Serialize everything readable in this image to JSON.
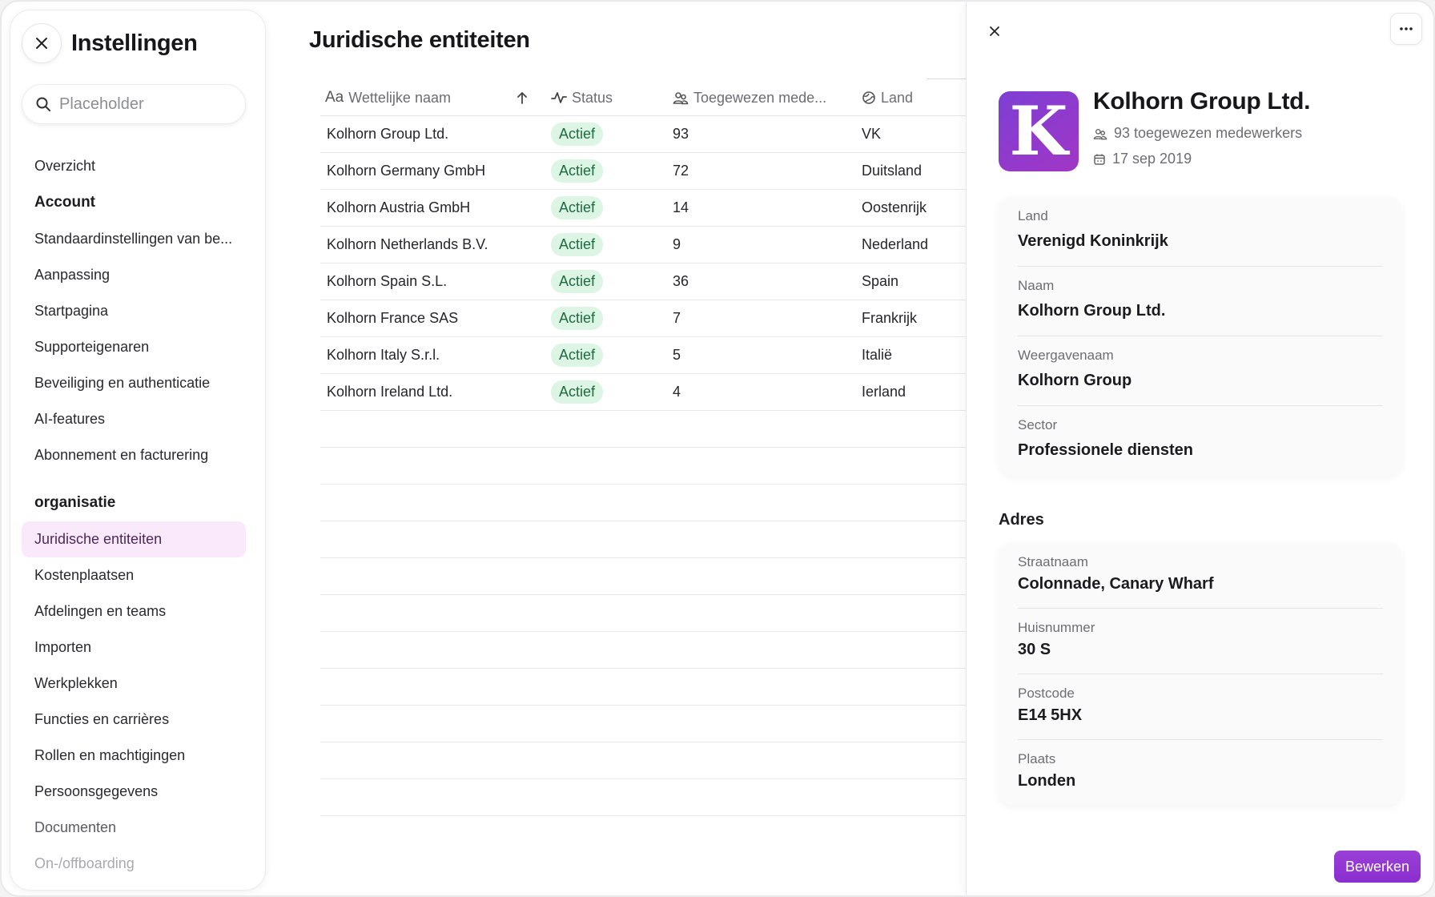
{
  "sidebar": {
    "title": "Instellingen",
    "search_placeholder": "Placeholder",
    "items": [
      {
        "type": "item",
        "label": "Overzicht"
      },
      {
        "type": "section",
        "label": "Account"
      },
      {
        "type": "item",
        "label": "Standaardinstellingen van be..."
      },
      {
        "type": "item",
        "label": "Aanpassing"
      },
      {
        "type": "item",
        "label": "Startpagina"
      },
      {
        "type": "item",
        "label": "Supporteigenaren"
      },
      {
        "type": "item",
        "label": "Beveiliging en authenticatie"
      },
      {
        "type": "item",
        "label": "AI-features"
      },
      {
        "type": "item",
        "label": "Abonnement en facturering"
      },
      {
        "type": "section",
        "label": "organisatie"
      },
      {
        "type": "item",
        "label": "Juridische entiteiten",
        "active": true
      },
      {
        "type": "item",
        "label": "Kostenplaatsen"
      },
      {
        "type": "item",
        "label": "Afdelingen en teams"
      },
      {
        "type": "item",
        "label": "Importen"
      },
      {
        "type": "item",
        "label": "Werkplekken"
      },
      {
        "type": "item",
        "label": "Functies en carrières"
      },
      {
        "type": "item",
        "label": "Rollen en machtigingen"
      },
      {
        "type": "item",
        "label": "Persoonsgegevens"
      },
      {
        "type": "item",
        "label": "Documenten",
        "dim": true
      },
      {
        "type": "item",
        "label": "On-/offboarding",
        "faded": true
      }
    ]
  },
  "main": {
    "title": "Juridische entiteiten",
    "columns": {
      "name": "Wettelijke naam",
      "status": "Status",
      "employees": "Toegewezen mede...",
      "country": "Land"
    },
    "rows": [
      {
        "name": "Kolhorn Group Ltd.",
        "status": "Actief",
        "employees": "93",
        "country": "VK"
      },
      {
        "name": "Kolhorn Germany GmbH",
        "status": "Actief",
        "employees": "72",
        "country": "Duitsland"
      },
      {
        "name": "Kolhorn Austria GmbH",
        "status": "Actief",
        "employees": "14",
        "country": "Oostenrijk"
      },
      {
        "name": "Kolhorn Netherlands B.V.",
        "status": "Actief",
        "employees": "9",
        "country": "Nederland"
      },
      {
        "name": "Kolhorn Spain S.L.",
        "status": "Actief",
        "employees": "36",
        "country": "Spain"
      },
      {
        "name": "Kolhorn France SAS",
        "status": "Actief",
        "employees": "7",
        "country": "Frankrijk"
      },
      {
        "name": "Kolhorn Italy S.r.l.",
        "status": "Actief",
        "employees": "5",
        "country": "Italië"
      },
      {
        "name": "Kolhorn Ireland Ltd.",
        "status": "Actief",
        "employees": "4",
        "country": "Ierland"
      }
    ]
  },
  "panel": {
    "logo_letter": "K",
    "name": "Kolhorn Group Ltd.",
    "employees_meta": "93 toegewezen medewerkers",
    "date_meta": "17 sep 2019",
    "details": [
      {
        "label": "Land",
        "value": "Verenigd Koninkrijk"
      },
      {
        "label": "Naam",
        "value": "Kolhorn Group Ltd."
      },
      {
        "label": "Weergavenaam",
        "value": "Kolhorn Group"
      },
      {
        "label": "Sector",
        "value": "Professionele diensten"
      }
    ],
    "address_title": "Adres",
    "address": [
      {
        "label": "Straatnaam",
        "value": "Colonnade, Canary Wharf"
      },
      {
        "label": "Huisnummer",
        "value": "30 S"
      },
      {
        "label": "Postcode",
        "value": "E14 5HX"
      },
      {
        "label": "Plaats",
        "value": "Londen"
      }
    ],
    "edit_label": "Bewerken"
  },
  "colors": {
    "accent": "#8a2fcf",
    "active_nav_bg": "#fae8fb",
    "badge_bg": "#dcf5e5",
    "badge_text": "#1d6b3f"
  }
}
